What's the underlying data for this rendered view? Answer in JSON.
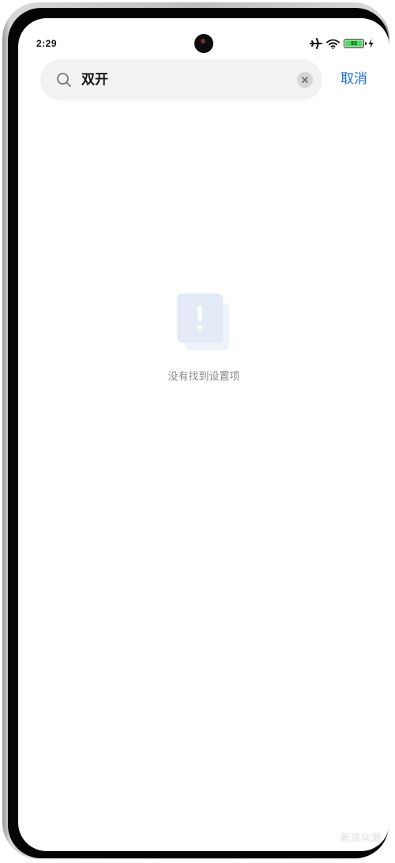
{
  "status_bar": {
    "time": "2:29",
    "battery_level": "93",
    "icons": [
      "airplane-icon",
      "wifi-icon",
      "battery-icon",
      "charging-icon"
    ]
  },
  "search": {
    "query": "双开",
    "cancel_label": "取消"
  },
  "empty_state": {
    "icon": "alert-document-icon",
    "message": "没有找到设置项"
  },
  "watermark": {
    "text": "新浪众测"
  },
  "colors": {
    "accent": "#1f6fd8",
    "search_bg": "#f2f2f2",
    "empty_text": "#8a8a8a"
  }
}
